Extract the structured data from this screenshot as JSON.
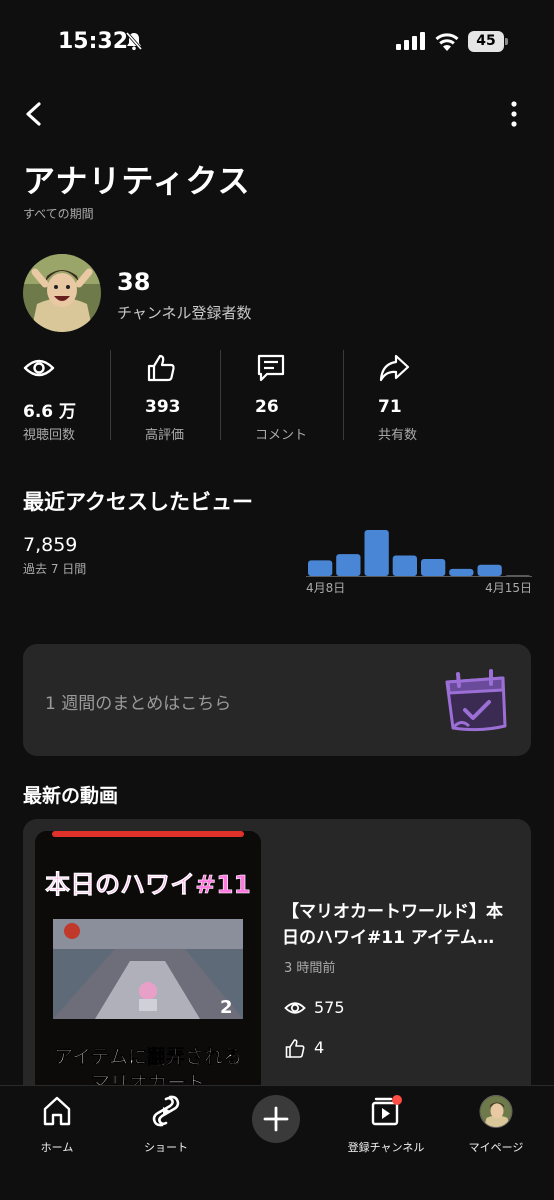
{
  "status_bar": {
    "time": "15:32",
    "battery": "45"
  },
  "header": {
    "title": "アナリティクス",
    "period": "すべての期間"
  },
  "channel": {
    "subscriber_count": "38",
    "subscriber_label": "チャンネル登録者数"
  },
  "stats": [
    {
      "icon": "eye-icon",
      "value": "6.6 万",
      "label": "視聴回数"
    },
    {
      "icon": "thumbs-up-icon",
      "value": "393",
      "label": "高評価"
    },
    {
      "icon": "comment-icon",
      "value": "26",
      "label": "コメント"
    },
    {
      "icon": "share-icon",
      "value": "71",
      "label": "共有数"
    }
  ],
  "recent_views": {
    "title": "最近アクセスしたビュー",
    "value": "7,859",
    "subtitle": "過去 7 日間"
  },
  "chart_data": {
    "type": "bar",
    "categories": [
      "4月8日",
      "",
      "",
      "",
      "",
      "",
      "",
      "4月15日"
    ],
    "values": [
      1100,
      1550,
      3250,
      1450,
      1200,
      500,
      800,
      0
    ],
    "x_tick_labels": [
      "4月8日",
      "4月15日"
    ],
    "bar_color": "#4a86d6"
  },
  "weekly_summary": {
    "text": "1 週間のまとめはこちら",
    "icon": "calendar-check-icon"
  },
  "latest": {
    "section_title": "最新の動画",
    "video": {
      "thumb_title": "本日のハワイ#11",
      "thumb_caption_1": "アイテムに翻弄される",
      "thumb_caption_2": "マリオカート",
      "title": "【マリオカートワールド】本日のハワイ#11 アイテム…",
      "age": "3 時間前",
      "views": "575",
      "likes": "4"
    }
  },
  "bottom_nav": {
    "home": "ホーム",
    "shorts": "ショート",
    "subscriptions": "登録チャンネル",
    "mypage": "マイページ"
  },
  "colors": {
    "background": "#0f0f0f",
    "card": "#272727",
    "accent_blue": "#4a86d6",
    "notification_red": "#ff4e45",
    "calendar_purple": "#9b6fd6"
  }
}
